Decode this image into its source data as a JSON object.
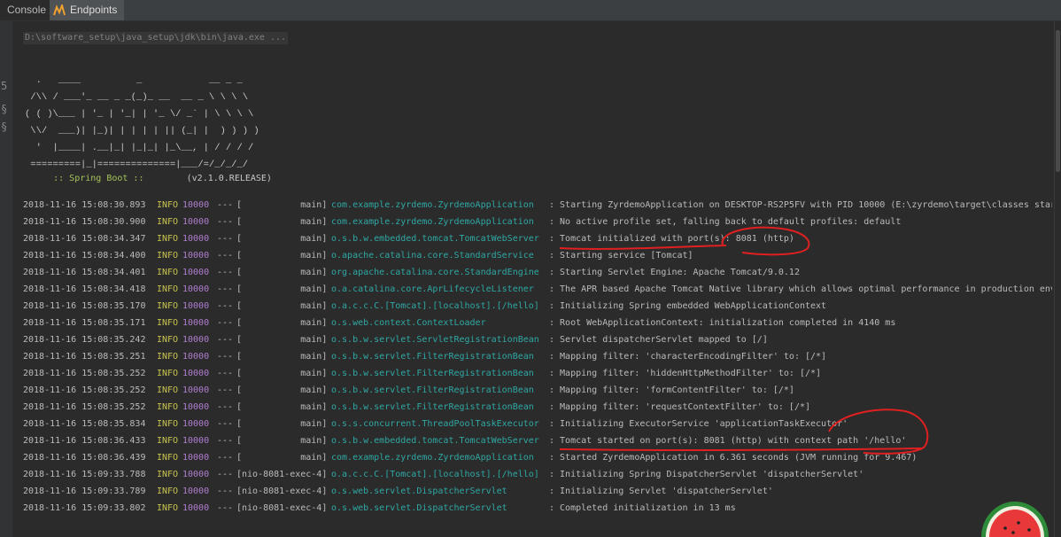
{
  "tabs": {
    "console": "Console",
    "endpoints": "Endpoints"
  },
  "gutter_glyphs": [
    "5",
    "§",
    "§"
  ],
  "command": "D:\\software_setup\\java_setup\\jdk\\bin\\java.exe ...",
  "banner_art": "  .   ____          _            __ _ _\n /\\\\ / ___'_ __ _ _(_)_ __  __ _ \\ \\ \\ \\\n( ( )\\___ | '_ | '_| | '_ \\/ _` | \\ \\ \\ \\\n \\\\/  ___)| |_)| | | | | || (_| |  ) ) ) )\n  '  |____| .__|_| |_|_| |_\\__, | / / / /\n =========|_|==============|___/=/_/_/_/",
  "spring_boot": {
    "tag": " :: Spring Boot :: ",
    "version": "       (v2.1.0.RELEASE)"
  },
  "log_rows": [
    {
      "ts": "2018-11-16 15:08:30.893",
      "level": "INFO",
      "pid": "10000",
      "sep": "---",
      "thread": "[           main]",
      "logger": "com.example.zyrdemo.ZyrdemoApplication",
      "msg": ": Starting ZyrdemoApplication on DESKTOP-RS2P5FV with PID 10000 (E:\\zyrdemo\\target\\classes star"
    },
    {
      "ts": "2018-11-16 15:08:30.900",
      "level": "INFO",
      "pid": "10000",
      "sep": "---",
      "thread": "[           main]",
      "logger": "com.example.zyrdemo.ZyrdemoApplication",
      "msg": ": No active profile set, falling back to default profiles: default"
    },
    {
      "ts": "2018-11-16 15:08:34.347",
      "level": "INFO",
      "pid": "10000",
      "sep": "---",
      "thread": "[           main]",
      "logger": "o.s.b.w.embedded.tomcat.TomcatWebServer",
      "msg": ": Tomcat initialized with port(s): 8081 (http)"
    },
    {
      "ts": "2018-11-16 15:08:34.400",
      "level": "INFO",
      "pid": "10000",
      "sep": "---",
      "thread": "[           main]",
      "logger": "o.apache.catalina.core.StandardService",
      "msg": ": Starting service [Tomcat]"
    },
    {
      "ts": "2018-11-16 15:08:34.401",
      "level": "INFO",
      "pid": "10000",
      "sep": "---",
      "thread": "[           main]",
      "logger": "org.apache.catalina.core.StandardEngine",
      "msg": ": Starting Servlet Engine: Apache Tomcat/9.0.12"
    },
    {
      "ts": "2018-11-16 15:08:34.418",
      "level": "INFO",
      "pid": "10000",
      "sep": "---",
      "thread": "[           main]",
      "logger": "o.a.catalina.core.AprLifecycleListener",
      "msg": ": The APR based Apache Tomcat Native library which allows optimal performance in production env"
    },
    {
      "ts": "2018-11-16 15:08:35.170",
      "level": "INFO",
      "pid": "10000",
      "sep": "---",
      "thread": "[           main]",
      "logger": "o.a.c.c.C.[Tomcat].[localhost].[/hello]",
      "msg": ": Initializing Spring embedded WebApplicationContext"
    },
    {
      "ts": "2018-11-16 15:08:35.171",
      "level": "INFO",
      "pid": "10000",
      "sep": "---",
      "thread": "[           main]",
      "logger": "o.s.web.context.ContextLoader",
      "msg": ": Root WebApplicationContext: initialization completed in 4140 ms"
    },
    {
      "ts": "2018-11-16 15:08:35.242",
      "level": "INFO",
      "pid": "10000",
      "sep": "---",
      "thread": "[           main]",
      "logger": "o.s.b.w.servlet.ServletRegistrationBean",
      "msg": ": Servlet dispatcherServlet mapped to [/]"
    },
    {
      "ts": "2018-11-16 15:08:35.251",
      "level": "INFO",
      "pid": "10000",
      "sep": "---",
      "thread": "[           main]",
      "logger": "o.s.b.w.servlet.FilterRegistrationBean",
      "msg": ": Mapping filter: 'characterEncodingFilter' to: [/*]"
    },
    {
      "ts": "2018-11-16 15:08:35.252",
      "level": "INFO",
      "pid": "10000",
      "sep": "---",
      "thread": "[           main]",
      "logger": "o.s.b.w.servlet.FilterRegistrationBean",
      "msg": ": Mapping filter: 'hiddenHttpMethodFilter' to: [/*]"
    },
    {
      "ts": "2018-11-16 15:08:35.252",
      "level": "INFO",
      "pid": "10000",
      "sep": "---",
      "thread": "[           main]",
      "logger": "o.s.b.w.servlet.FilterRegistrationBean",
      "msg": ": Mapping filter: 'formContentFilter' to: [/*]"
    },
    {
      "ts": "2018-11-16 15:08:35.252",
      "level": "INFO",
      "pid": "10000",
      "sep": "---",
      "thread": "[           main]",
      "logger": "o.s.b.w.servlet.FilterRegistrationBean",
      "msg": ": Mapping filter: 'requestContextFilter' to: [/*]"
    },
    {
      "ts": "2018-11-16 15:08:35.834",
      "level": "INFO",
      "pid": "10000",
      "sep": "---",
      "thread": "[           main]",
      "logger": "o.s.s.concurrent.ThreadPoolTaskExecutor",
      "msg": ": Initializing ExecutorService 'applicationTaskExecutor'"
    },
    {
      "ts": "2018-11-16 15:08:36.433",
      "level": "INFO",
      "pid": "10000",
      "sep": "---",
      "thread": "[           main]",
      "logger": "o.s.b.w.embedded.tomcat.TomcatWebServer",
      "msg": ": Tomcat started on port(s): 8081 (http) with context path '/hello'"
    },
    {
      "ts": "2018-11-16 15:08:36.439",
      "level": "INFO",
      "pid": "10000",
      "sep": "---",
      "thread": "[           main]",
      "logger": "com.example.zyrdemo.ZyrdemoApplication",
      "msg": ": Started ZyrdemoApplication in 6.361 seconds (JVM running for 9.467)"
    },
    {
      "ts": "2018-11-16 15:09:33.788",
      "level": "INFO",
      "pid": "10000",
      "sep": "---",
      "thread": "[nio-8081-exec-4]",
      "logger": "o.a.c.c.C.[Tomcat].[localhost].[/hello]",
      "msg": ": Initializing Spring DispatcherServlet 'dispatcherServlet'"
    },
    {
      "ts": "2018-11-16 15:09:33.789",
      "level": "INFO",
      "pid": "10000",
      "sep": "---",
      "thread": "[nio-8081-exec-4]",
      "logger": "o.s.web.servlet.DispatcherServlet",
      "msg": ": Initializing Servlet 'dispatcherServlet'"
    },
    {
      "ts": "2018-11-16 15:09:33.802",
      "level": "INFO",
      "pid": "10000",
      "sep": "---",
      "thread": "[nio-8081-exec-4]",
      "logger": "o.s.web.servlet.DispatcherServlet",
      "msg": ": Completed initialization in 13 ms"
    }
  ],
  "colors": {
    "background": "#2b2b2b",
    "timestamp": "#bbbbbb",
    "level_info": "#c8c34f",
    "pid": "#b07dd0",
    "logger": "#2fa8a4",
    "spring_tag": "#a5c25c",
    "annotation": "#e02020"
  },
  "icons": {
    "endpoints": "endpoints-icon",
    "corner_decoration": "watermelon-icon"
  }
}
